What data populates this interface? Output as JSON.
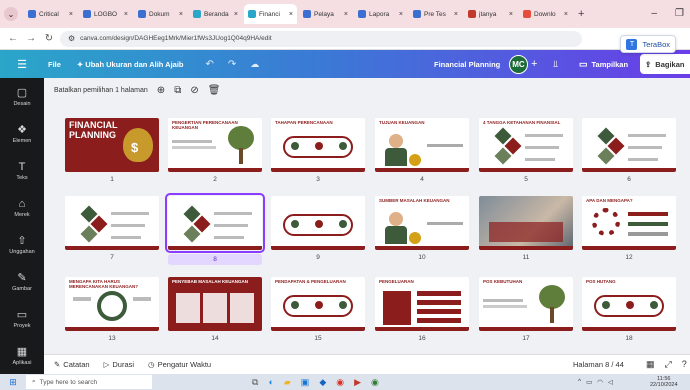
{
  "browser": {
    "tabs": [
      {
        "label": "Critical",
        "color": "#3b6fd1"
      },
      {
        "label": "LOGBO",
        "color": "#3b6fd1"
      },
      {
        "label": "Dokum",
        "color": "#3b6fd1"
      },
      {
        "label": "Beranda",
        "color": "#2aa6c9"
      },
      {
        "label": "Financi",
        "color": "#2aa6c9"
      },
      {
        "label": "Pelaya",
        "color": "#3b6fd1"
      },
      {
        "label": "Lapora",
        "color": "#3b6fd1"
      },
      {
        "label": "Pre Tes",
        "color": "#3b6fd1"
      },
      {
        "label": "jtanya",
        "color": "#c0392b"
      },
      {
        "label": "Downlo",
        "color": "#e74c3c"
      }
    ],
    "active_tab_index": 4,
    "url": "canva.com/design/DAGHEeg1Mrk/Mier1fWs3JUog1Q04q9HA/edit",
    "terabox_label": "TeraBox"
  },
  "topbar": {
    "file_label": "File",
    "resize_label": "Ubah Ukuran dan Alih Ajaib",
    "doc_title": "Financial Planning",
    "avatar_initials": "MC",
    "present_label": "Tampilkan",
    "share_label": "Bagikan"
  },
  "sidebar": {
    "items": [
      {
        "label": "Desain",
        "icon": "layout-icon"
      },
      {
        "label": "Elemen",
        "icon": "shapes-icon"
      },
      {
        "label": "Teks",
        "icon": "text-icon"
      },
      {
        "label": "Merek",
        "icon": "brand-icon"
      },
      {
        "label": "Unggahan",
        "icon": "upload-icon"
      },
      {
        "label": "Gambar",
        "icon": "draw-icon"
      },
      {
        "label": "Proyek",
        "icon": "folder-icon"
      },
      {
        "label": "Aplikasi",
        "icon": "apps-icon"
      }
    ]
  },
  "toolbar": {
    "deselect_label": "Batalkan pemilihan 1 halaman"
  },
  "slides": [
    {
      "num": "1",
      "title": "FINANCIAL PLANNING",
      "variant": "cover"
    },
    {
      "num": "2",
      "title": "PENGERTIAN PERENCANAAN KEUANGAN",
      "variant": "tree"
    },
    {
      "num": "3",
      "title": "TAHAPAN PERENCANAAN",
      "variant": "flow"
    },
    {
      "num": "4",
      "title": "TUJUAN KEUANGAN",
      "variant": "person"
    },
    {
      "num": "5",
      "title": "4 TANGGA KETAHANAN FINANSIAL",
      "variant": "cubes"
    },
    {
      "num": "6",
      "title": "",
      "variant": "cubes"
    },
    {
      "num": "7",
      "title": "",
      "variant": "cubes"
    },
    {
      "num": "8",
      "title": "",
      "variant": "cubes"
    },
    {
      "num": "9",
      "title": "",
      "variant": "flow"
    },
    {
      "num": "10",
      "title": "SUMBER MASALAH KEUANGAN",
      "variant": "person"
    },
    {
      "num": "11",
      "title": "",
      "variant": "photo"
    },
    {
      "num": "12",
      "title": "APA DAN MENGAPA?",
      "variant": "gear"
    },
    {
      "num": "13",
      "title": "MENGAPA KITA HARUS MERENCANAKAN KEUANGAN?",
      "variant": "cycle"
    },
    {
      "num": "14",
      "title": "PENYEBAB MASALAH KEUANGAN",
      "variant": "grid"
    },
    {
      "num": "15",
      "title": "PENDAPATAN & PENGELUARAN",
      "variant": "flow"
    },
    {
      "num": "16",
      "title": "PENGELUARAN",
      "variant": "list"
    },
    {
      "num": "17",
      "title": "POS KEBUTUHAN",
      "variant": "tree"
    },
    {
      "num": "18",
      "title": "POS HUTANG",
      "variant": "flow"
    }
  ],
  "selected_slide_index": 7,
  "footer": {
    "notes_label": "Catatan",
    "duration_label": "Durasi",
    "timer_label": "Pengatur Waktu",
    "page_info": "Halaman 8 / 44"
  },
  "taskbar": {
    "search_placeholder": "Type here to search",
    "time": "11:56",
    "date": "22/10/2024"
  },
  "colors": {
    "slide_accent": "#8c1d1d",
    "slide_green": "#3d5a3a",
    "selection": "#8b3dff"
  }
}
